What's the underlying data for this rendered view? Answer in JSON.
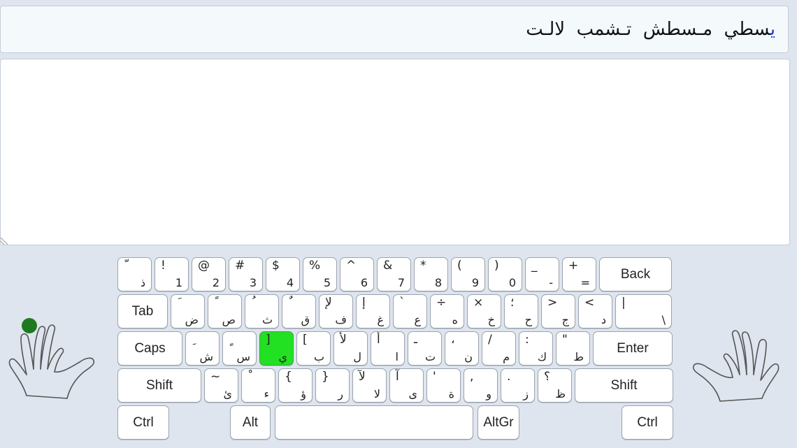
{
  "target": {
    "current_char": "ي",
    "rest_text": "سطي  مـسطش  تـشمب  لالـت"
  },
  "keyboard": {
    "rows": [
      [
        {
          "id": "key-backtick",
          "shift": "ّ",
          "base": "ذ"
        },
        {
          "id": "key-1",
          "shift": "!",
          "base": "1"
        },
        {
          "id": "key-2",
          "shift": "@",
          "base": "2"
        },
        {
          "id": "key-3",
          "shift": "#",
          "base": "3"
        },
        {
          "id": "key-4",
          "shift": "$",
          "base": "4"
        },
        {
          "id": "key-5",
          "shift": "%",
          "base": "5"
        },
        {
          "id": "key-6",
          "shift": "^",
          "base": "6"
        },
        {
          "id": "key-7",
          "shift": "&",
          "base": "7"
        },
        {
          "id": "key-8",
          "shift": "*",
          "base": "8"
        },
        {
          "id": "key-9",
          "shift": "(",
          "base": "9"
        },
        {
          "id": "key-0",
          "shift": ")",
          "base": "0"
        },
        {
          "id": "key-minus",
          "shift": "_",
          "base": "-"
        },
        {
          "id": "key-equals",
          "shift": "+",
          "base": "="
        },
        {
          "id": "key-back",
          "label": "Back"
        }
      ],
      [
        {
          "id": "key-tab",
          "label": "Tab"
        },
        {
          "id": "key-q",
          "shift": "َ",
          "base": "ض"
        },
        {
          "id": "key-w",
          "shift": "ً",
          "base": "ص"
        },
        {
          "id": "key-e",
          "shift": "ُ",
          "base": "ث"
        },
        {
          "id": "key-r",
          "shift": "ٌ",
          "base": "ق"
        },
        {
          "id": "key-t",
          "shift": "لإ",
          "base": "ف"
        },
        {
          "id": "key-y",
          "shift": "إ",
          "base": "غ"
        },
        {
          "id": "key-u",
          "shift": "`",
          "base": "ع"
        },
        {
          "id": "key-i",
          "shift": "÷",
          "base": "ه"
        },
        {
          "id": "key-o",
          "shift": "×",
          "base": "خ"
        },
        {
          "id": "key-p",
          "shift": "؛",
          "base": "ح"
        },
        {
          "id": "key-lbracket",
          "shift": ">",
          "base": "ج"
        },
        {
          "id": "key-rbracket",
          "shift": "<",
          "base": "د"
        },
        {
          "id": "key-backslash",
          "shift": "|",
          "base": "\\"
        }
      ],
      [
        {
          "id": "key-caps",
          "label": "Caps"
        },
        {
          "id": "key-a",
          "shift": "ِ",
          "base": "ش"
        },
        {
          "id": "key-s",
          "shift": "ٍ",
          "base": "س"
        },
        {
          "id": "key-d",
          "shift": "]",
          "base": "ي"
        },
        {
          "id": "key-f",
          "shift": "[",
          "base": "ب"
        },
        {
          "id": "key-g",
          "shift": "لأ",
          "base": "ل"
        },
        {
          "id": "key-h",
          "shift": "أ",
          "base": "ا"
        },
        {
          "id": "key-j",
          "shift": "ـ",
          "base": "ت"
        },
        {
          "id": "key-k",
          "shift": "،",
          "base": "ن"
        },
        {
          "id": "key-l",
          "shift": "/",
          "base": "م"
        },
        {
          "id": "key-semicolon",
          "shift": ":",
          "base": "ك"
        },
        {
          "id": "key-quote",
          "shift": "\"",
          "base": "ط"
        },
        {
          "id": "key-enter",
          "label": "Enter"
        }
      ],
      [
        {
          "id": "key-shift-left",
          "label": "Shift"
        },
        {
          "id": "key-z",
          "shift": "~",
          "base": "ئ"
        },
        {
          "id": "key-x",
          "shift": "ْ",
          "base": "ء"
        },
        {
          "id": "key-c",
          "shift": "{",
          "base": "ؤ"
        },
        {
          "id": "key-v",
          "shift": "}",
          "base": "ر"
        },
        {
          "id": "key-b",
          "shift": "لآ",
          "base": "لا"
        },
        {
          "id": "key-n",
          "shift": "آ",
          "base": "ى"
        },
        {
          "id": "key-m",
          "shift": "'",
          "base": "ة"
        },
        {
          "id": "key-comma",
          "shift": ",",
          "base": "و"
        },
        {
          "id": "key-period",
          "shift": ".",
          "base": "ز"
        },
        {
          "id": "key-slash",
          "shift": "؟",
          "base": "ظ"
        },
        {
          "id": "key-shift-right",
          "label": "Shift"
        }
      ],
      [
        {
          "id": "key-ctrl-left",
          "label": "Ctrl"
        },
        {
          "id": "key-alt",
          "label": "Alt"
        },
        {
          "id": "key-space",
          "label": ""
        },
        {
          "id": "key-altgr",
          "label": "AltGr"
        },
        {
          "id": "key-ctrl-right",
          "label": "Ctrl"
        }
      ]
    ],
    "highlighted_key": "key-d",
    "highlight_color": "#22e022"
  },
  "hands": {
    "left_active_finger": "pinky",
    "finger_marker_color": "#1f7a1f"
  }
}
